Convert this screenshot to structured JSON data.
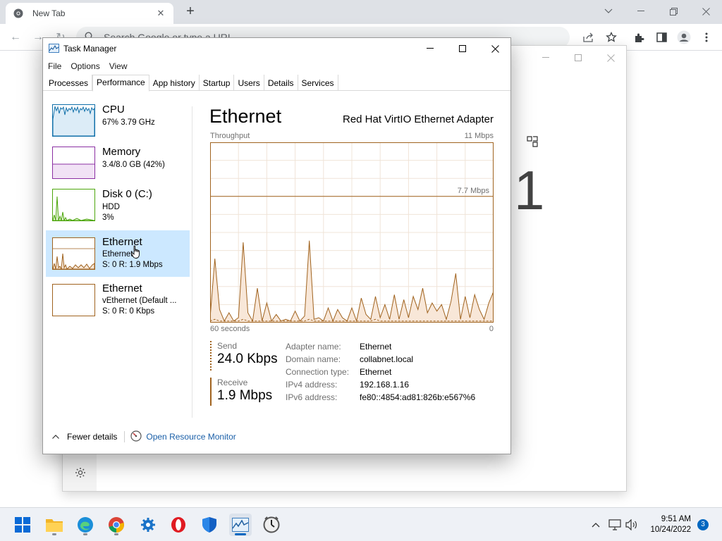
{
  "browser": {
    "tab_title": "New Tab",
    "omnibox_placeholder": "Search Google or type a URL"
  },
  "background_window": {
    "big_text": "1"
  },
  "task_manager": {
    "title": "Task Manager",
    "menu": [
      "File",
      "Options",
      "View"
    ],
    "tabs": [
      "Processes",
      "Performance",
      "App history",
      "Startup",
      "Users",
      "Details",
      "Services"
    ],
    "active_tab": "Performance",
    "perf_items": [
      {
        "name": "CPU",
        "sub1": "67%  3.79 GHz",
        "sub2": "",
        "color": "#1170aa"
      },
      {
        "name": "Memory",
        "sub1": "3.4/8.0 GB (42%)",
        "sub2": "",
        "color": "#8b2fa3"
      },
      {
        "name": "Disk 0 (C:)",
        "sub1": "HDD",
        "sub2": "3%",
        "color": "#4da60c"
      },
      {
        "name": "Ethernet",
        "sub1": "Ethernet",
        "sub2": "S: 0  R: 1.9 Mbps",
        "color": "#a0631f"
      },
      {
        "name": "Ethernet",
        "sub1": "vEthernet (Default ...",
        "sub2": "S: 0  R: 0 Kbps",
        "color": "#a0631f"
      }
    ],
    "detail": {
      "title": "Ethernet",
      "adapter": "Red Hat VirtIO Ethernet Adapter",
      "throughput_label": "Throughput",
      "max_label": "11 Mbps",
      "mid_label": "7.7 Mbps",
      "x_left_label": "60 seconds",
      "x_right_label": "0",
      "send_label": "Send",
      "send_value": "24.0 Kbps",
      "receive_label": "Receive",
      "receive_value": "1.9 Mbps",
      "info": [
        {
          "key": "Adapter name:",
          "value": "Ethernet"
        },
        {
          "key": "Domain name:",
          "value": "collabnet.local"
        },
        {
          "key": "Connection type:",
          "value": "Ethernet"
        },
        {
          "key": "IPv4 address:",
          "value": "192.168.1.16"
        },
        {
          "key": "IPv6 address:",
          "value": "fe80::4854:ad81:826b:e567%6"
        }
      ]
    },
    "footer": {
      "fewer_details": "Fewer details",
      "open_resource_monitor": "Open Resource Monitor"
    }
  },
  "chart_data": {
    "type": "area",
    "title": "Throughput",
    "xlabel": "60 seconds",
    "ylabel": "",
    "xlim": [
      60,
      0
    ],
    "ylim": [
      0,
      11
    ],
    "y_unit": "Mbps",
    "reference_line": 7.7,
    "series": [
      {
        "name": "Receive",
        "values": [
          0.3,
          3.9,
          0.8,
          0.1,
          0.6,
          0.1,
          0.3,
          4.9,
          0.6,
          0.1,
          2.1,
          0.1,
          1.2,
          0.1,
          0.5,
          0.1,
          0.2,
          0.1,
          0.7,
          0.1,
          0.4,
          5.0,
          0.2,
          0.3,
          0.1,
          0.9,
          0.1,
          0.8,
          0.3,
          0.1,
          0.9,
          0.1,
          1.5,
          0.5,
          0.2,
          1.6,
          0.3,
          1.1,
          0.2,
          1.7,
          0.2,
          1.4,
          0.3,
          1.6,
          0.8,
          2.1,
          0.6,
          1.2,
          0.7,
          1.1,
          0.2,
          1.3,
          3.0,
          0.2,
          1.6,
          0.3,
          1.7,
          0.8,
          0.2,
          1.2,
          1.9
        ]
      },
      {
        "name": "Send",
        "values": [
          0.1,
          0.2,
          0.1,
          0.1,
          0.1,
          0.1,
          0.1,
          0.2,
          0.1,
          0.1,
          0.1,
          0.1,
          0.1,
          0.1,
          0.1,
          0.1,
          0.1,
          0.1,
          0.1,
          0.1,
          0.1,
          0.2,
          0.1,
          0.1,
          0.1,
          0.1,
          0.1,
          0.1,
          0.1,
          0.1,
          0.1,
          0.1,
          0.1,
          0.1,
          0.1,
          0.2,
          0.1,
          0.1,
          0.1,
          0.1,
          0.1,
          0.1,
          0.1,
          0.1,
          0.1,
          0.1,
          0.1,
          0.1,
          0.1,
          0.1,
          0.1,
          0.1,
          0.1,
          0.1,
          0.1,
          0.1,
          0.1,
          0.1,
          0.1,
          0.1,
          0.1
        ]
      }
    ],
    "grid": true,
    "color": "#a0631f"
  },
  "taskbar": {
    "apps": [
      "start-icon",
      "file-explorer-icon",
      "edge-icon",
      "chrome-icon",
      "gear-network-icon",
      "opera-icon",
      "defender-icon",
      "task-manager-icon",
      "clock-app-icon"
    ],
    "time": "9:51 AM",
    "date": "10/24/2022",
    "notification_count": "3"
  }
}
